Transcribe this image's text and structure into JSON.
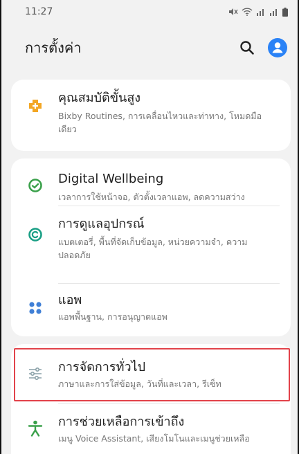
{
  "status": {
    "time": "11:27"
  },
  "appbar": {
    "title": "การตั้งค่า",
    "search_icon": "search-icon",
    "account_icon": "account-icon"
  },
  "colors": {
    "background": "#f2f2f2",
    "card": "#ffffff",
    "advanced_icon": "#f3a623",
    "wellbeing_icon": "#3aa04a",
    "device_care_icon": "#1a9f85",
    "apps_icon": "#3f7fd6",
    "general_icon": "#8aa1a8",
    "accessibility_icon": "#3aa04a",
    "account": "#2a82f6",
    "highlight": "#e2424a"
  },
  "cards": [
    {
      "items": [
        {
          "icon": "advanced-features-icon",
          "title": "คุณสมบัติขั้นสูง",
          "subtitle": "Bixby Routines, การเคลื่อนไหวและท่าทาง, โหมดมือเดียว"
        }
      ]
    },
    {
      "items": [
        {
          "icon": "digital-wellbeing-icon",
          "title": "Digital Wellbeing",
          "subtitle": "เวลาการใช้หน้าจอ, ตัวตั้งเวลาแอพ, ลดความสว่าง"
        },
        {
          "icon": "device-care-icon",
          "title": "การดูแลอุปกรณ์",
          "subtitle": "แบตเตอรี่, พื้นที่จัดเก็บข้อมูล, หน่วยความจำ, ความปลอดภัย"
        },
        {
          "icon": "apps-icon",
          "title": "แอพ",
          "subtitle": "แอพพื้นฐาน, การอนุญาตแอพ"
        }
      ]
    },
    {
      "items": [
        {
          "icon": "general-management-icon",
          "title": "การจัดการทั่วไป",
          "subtitle": "ภาษาและการใส่ข้อมูล, วันที่และเวลา, รีเซ็ท"
        },
        {
          "icon": "accessibility-icon",
          "title": "การช่วยเหลือการเข้าถึง",
          "subtitle": "เมนู Voice Assistant, เสียงโมโนและเมนูช่วยเหลือ"
        }
      ]
    }
  ]
}
